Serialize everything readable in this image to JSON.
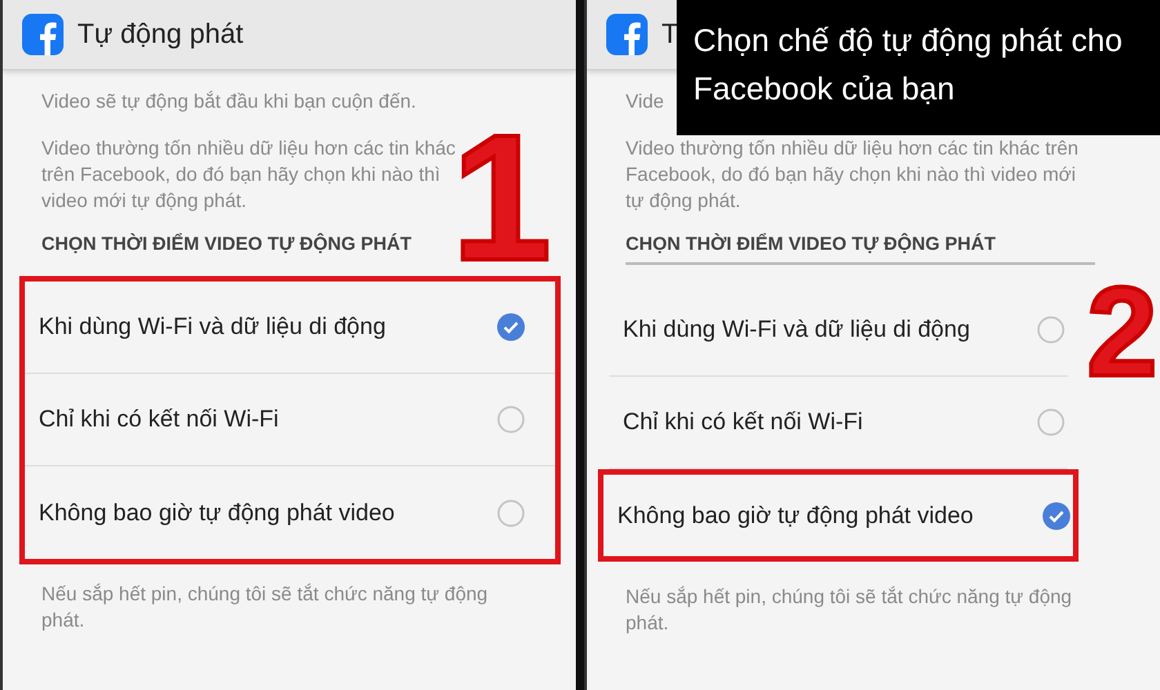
{
  "annotation": {
    "caption": "Chọn chế độ tự động phát cho Facebook của bạn"
  },
  "panels": [
    {
      "step": "1",
      "title": "Tự động phát",
      "intro": "Video sẽ tự động bắt đầu khi bạn cuộn đến.",
      "description": "Video thường tốn nhiều dữ liệu hơn các tin khác trên Facebook, do đó bạn hãy chọn khi nào thì video mới tự động phát.",
      "section_heading": "CHỌN THỜI ĐIỂM VIDEO TỰ ĐỘNG PHÁT",
      "options_framed": true,
      "options": [
        {
          "label": "Khi dùng Wi-Fi và dữ liệu di động",
          "selected": true,
          "framed": false
        },
        {
          "label": "Chỉ khi có kết nối Wi-Fi",
          "selected": false,
          "framed": false
        },
        {
          "label": "Không bao giờ tự động phát video",
          "selected": false,
          "framed": false
        }
      ],
      "footer": "Nếu sắp hết pin, chúng tôi sẽ tắt chức năng tự động phát."
    },
    {
      "step": "2",
      "title": "T",
      "intro": "Vide",
      "description": "Video thường tốn nhiều dữ liệu hơn các tin khác trên Facebook, do đó bạn hãy chọn khi nào thì video mới tự động phát.",
      "section_heading": "CHỌN THỜI ĐIỂM VIDEO TỰ ĐỘNG PHÁT",
      "options_framed": false,
      "options": [
        {
          "label": "Khi dùng Wi-Fi và dữ liệu di động",
          "selected": false,
          "framed": false
        },
        {
          "label": "Chỉ khi có kết nối Wi-Fi",
          "selected": false,
          "framed": false
        },
        {
          "label": "Không bao giờ tự động phát video",
          "selected": true,
          "framed": true
        }
      ],
      "footer": "Nếu sắp hết pin, chúng tôi sẽ tắt chức năng tự động phát."
    }
  ]
}
